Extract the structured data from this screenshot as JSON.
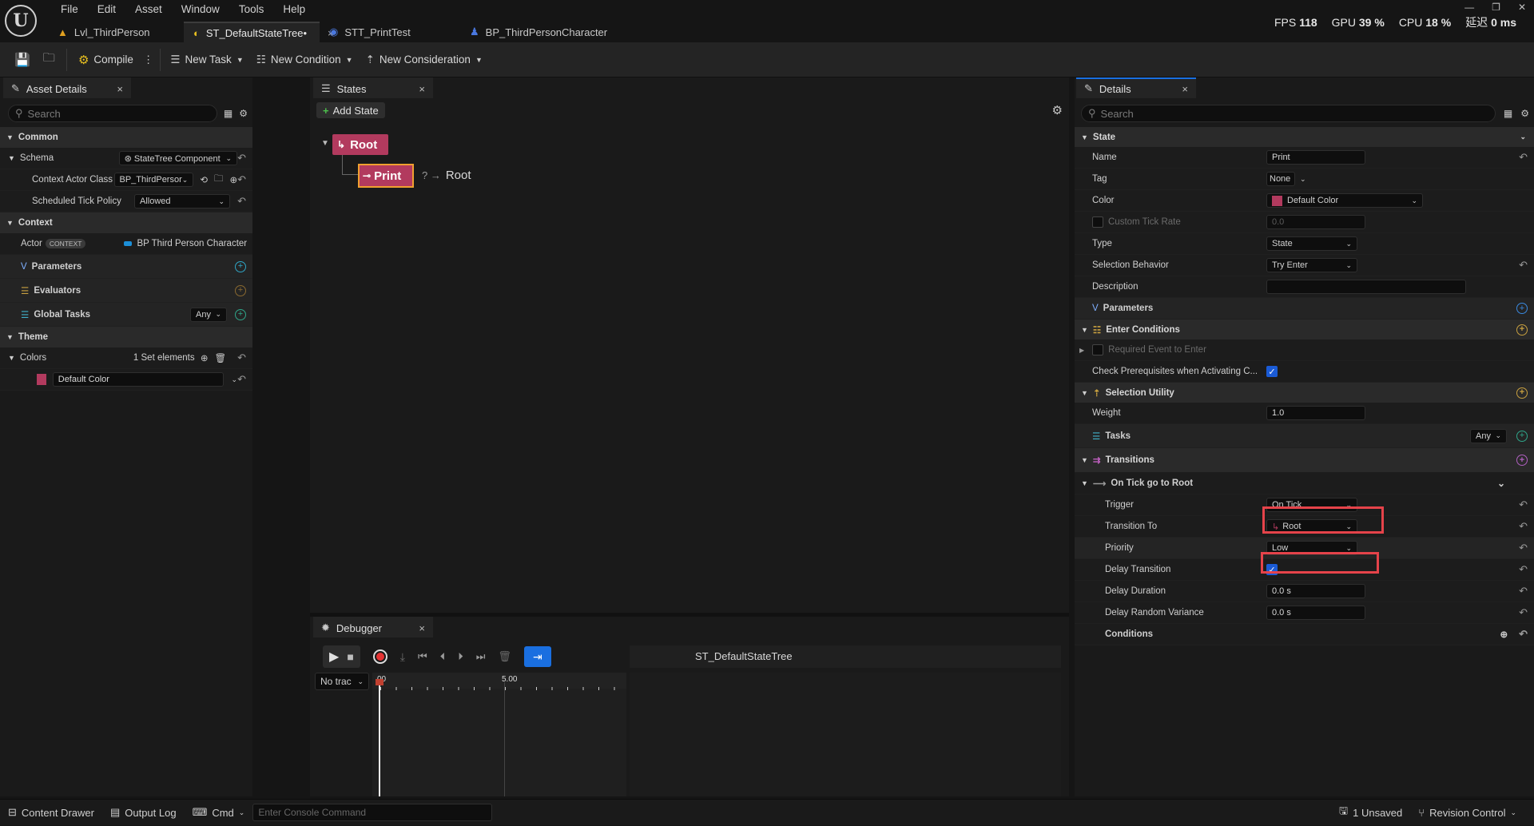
{
  "menu": [
    "File",
    "Edit",
    "Asset",
    "Window",
    "Tools",
    "Help"
  ],
  "tabs": [
    {
      "label": "Lvl_ThirdPerson",
      "icon": "level-icon"
    },
    {
      "label": "ST_DefaultStateTree•",
      "icon": "statetree-icon",
      "close": "×"
    },
    {
      "label": "STT_PrintTest",
      "icon": "task-icon"
    },
    {
      "label": "BP_ThirdPersonCharacter",
      "icon": "character-icon"
    }
  ],
  "stats": {
    "fps_label": "FPS",
    "fps": "118",
    "gpu_label": "GPU",
    "gpu": "39 %",
    "cpu_label": "CPU",
    "cpu": "18 %",
    "latency_label": "延迟",
    "latency": "0 ms"
  },
  "toolbar": {
    "compile": "Compile",
    "new_task": "New Task",
    "new_condition": "New Condition",
    "new_consideration": "New Consideration"
  },
  "asset_details": {
    "tab": "Asset Details",
    "search_placeholder": "Search",
    "common": "Common",
    "schema_label": "Schema",
    "schema_value": "StateTree Component",
    "context_actor_label": "Context Actor Class",
    "context_actor_value": "BP_ThirdPersor",
    "tick_policy_label": "Scheduled Tick Policy",
    "tick_policy_value": "Allowed",
    "context": "Context",
    "actor_label": "Actor",
    "actor_badge": "CONTEXT",
    "actor_value": "BP Third Person Character",
    "parameters": "Parameters",
    "evaluators": "Evaluators",
    "global_tasks": "Global Tasks",
    "global_tasks_value": "Any",
    "theme": "Theme",
    "colors_label": "Colors",
    "colors_value": "1 Set elements",
    "color_entry": "Default Color"
  },
  "states": {
    "tab": "States",
    "add_state": "Add State",
    "root": "Root",
    "child": "Print",
    "transition_marker": "? →",
    "transition_target": "Root"
  },
  "debugger": {
    "tab": "Debugger",
    "track_select": "No trac",
    "tree_name": "ST_DefaultStateTree",
    "tick_start": "00",
    "tick_mid": "5.00"
  },
  "details": {
    "tab": "Details",
    "search_placeholder": "Search",
    "state_cat": "State",
    "name_label": "Name",
    "name_value": "Print",
    "tag_label": "Tag",
    "tag_value": "None",
    "color_label": "Color",
    "color_value": "Default Color",
    "tick_rate_label": "Custom Tick Rate",
    "tick_rate_value": "0.0",
    "type_label": "Type",
    "type_value": "State",
    "selection_label": "Selection Behavior",
    "selection_value": "Try Enter",
    "description_label": "Description",
    "parameters": "Parameters",
    "enter_conditions": "Enter Conditions",
    "required_event": "Required Event to Enter",
    "check_prereq": "Check Prerequisites when Activating C...",
    "selection_utility": "Selection Utility",
    "weight_label": "Weight",
    "weight_value": "1.0",
    "tasks": "Tasks",
    "tasks_value": "Any",
    "transitions": "Transitions",
    "transition_name": "On Tick go to Root",
    "trigger_label": "Trigger",
    "trigger_value": "On Tick",
    "transition_to_label": "Transition To",
    "transition_to_value": "Root",
    "priority_label": "Priority",
    "priority_value": "Low",
    "delay_transition_label": "Delay Transition",
    "delay_duration_label": "Delay Duration",
    "delay_duration_value": "0.0 s",
    "delay_variance_label": "Delay Random Variance",
    "delay_variance_value": "0.0 s",
    "conditions": "Conditions"
  },
  "statusbar": {
    "content_drawer": "Content Drawer",
    "output_log": "Output Log",
    "cmd": "Cmd",
    "console_placeholder": "Enter Console Command",
    "unsaved": "1 Unsaved",
    "revision": "Revision Control"
  },
  "colors": {
    "accent": "#1a5bd6",
    "state_color": "#b23a5e",
    "highlight": "#e5434a",
    "selected_border": "#f0a030"
  }
}
